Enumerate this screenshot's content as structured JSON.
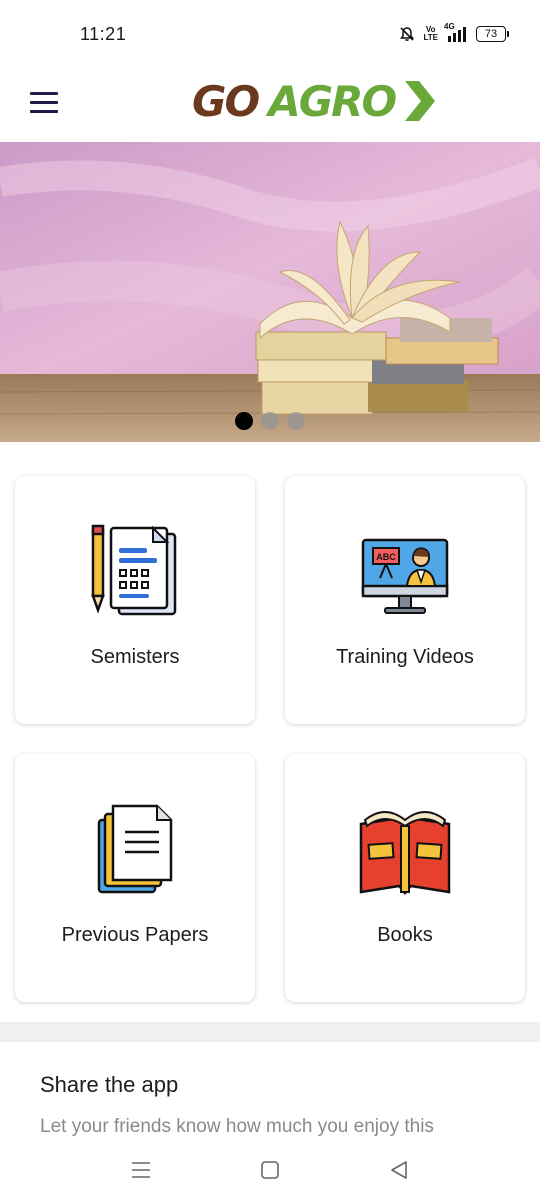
{
  "status_bar": {
    "time": "11:21",
    "network_top": "Vo",
    "network_bottom": "LTE",
    "signal": "4G",
    "battery": "73"
  },
  "header": {
    "logo_part1": "GO",
    "logo_part2": "AGRO"
  },
  "banner": {
    "slide_count": 3,
    "active_slide": 1
  },
  "cards": [
    {
      "label": "Semisters",
      "icon": "exam-paper-icon"
    },
    {
      "label": "Training Videos",
      "icon": "video-lesson-icon"
    },
    {
      "label": "Previous Papers",
      "icon": "documents-icon"
    },
    {
      "label": "Books",
      "icon": "open-book-icon"
    }
  ],
  "share": {
    "title": "Share the app",
    "subtitle": "Let your friends know how much you enjoy this"
  },
  "colors": {
    "logo_brown": "#6b3a1e",
    "logo_green": "#6aa83a",
    "menu_icon": "#1e1b4b"
  }
}
